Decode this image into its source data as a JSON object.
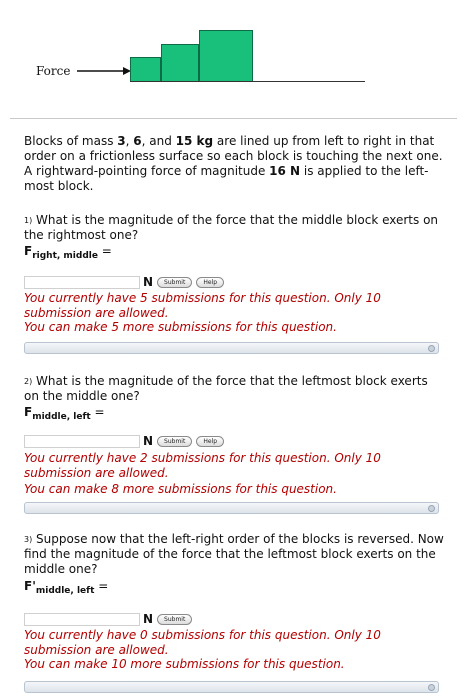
{
  "figure": {
    "force_label": "Force"
  },
  "problem": {
    "intro": {
      "t1": "Blocks of mass ",
      "m1": "3",
      "t2": ", ",
      "m2": "6",
      "t3": ", and ",
      "m3": "15 kg",
      "t4": " are lined up from left to right in that order on a frictionless surface so each block is touching the next one. A rightward-pointing force of magnitude ",
      "f": "16 N",
      "t5": " is applied to the left-most block."
    }
  },
  "questions": [
    {
      "number": "1)",
      "text": "What is the magnitude of the force that the middle block exerts on the rightmost one?",
      "var_symbol": "F",
      "var_sub": "right, middle",
      "equals": "=",
      "value": "",
      "unit": "N",
      "submit_label": "Submit",
      "help_label": "Help",
      "msg1": "You currently have 5 submissions for this question. Only 10 submission are allowed.",
      "msg2": "You can make 5 more submissions for this question."
    },
    {
      "number": "2)",
      "text": "What is the magnitude of the force that the leftmost block exerts on the middle one?",
      "var_symbol": "F",
      "var_sub": "middle, left",
      "equals": "=",
      "value": "",
      "unit": "N",
      "submit_label": "Submit",
      "help_label": "Help",
      "msg1": "You currently have 2 submissions for this question. Only 10 submission are allowed.",
      "msg2": "You can make 8 more submissions for this question."
    },
    {
      "number": "3)",
      "text": "Suppose now that the left-right order of the blocks is reversed. Now find the magnitude of the force that the leftmost block exerts on the middle one?",
      "var_symbol": "F'",
      "var_sub": "middle, left",
      "equals": "=",
      "value": "",
      "unit": "N",
      "submit_label": "Submit",
      "msg1": "You currently have 0 submissions for this question. Only 10 submission are allowed.",
      "msg2": "You can make 10 more submissions for this question."
    }
  ]
}
